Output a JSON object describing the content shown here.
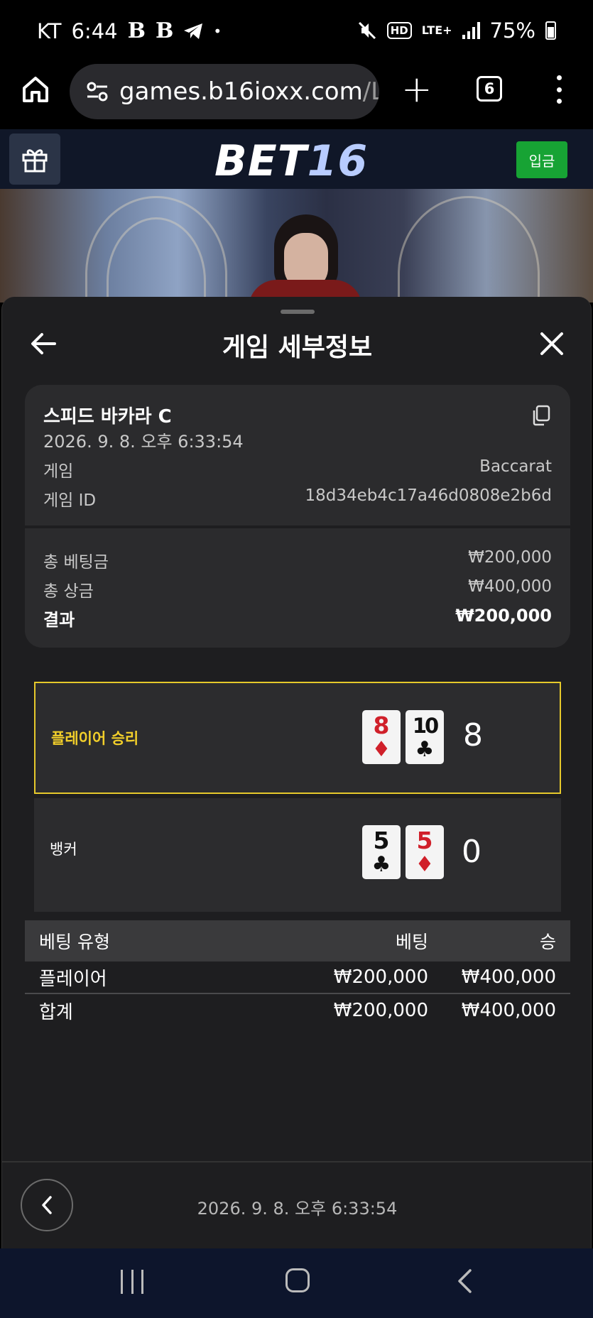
{
  "status_bar": {
    "carrier": "KT",
    "time": "6:44",
    "app_icons": [
      "B",
      "B"
    ],
    "network": "LTE+",
    "hd": "HD",
    "battery": "75%"
  },
  "browser": {
    "url_main": "games.b16ioxx.com",
    "url_rest": "/La",
    "tab_count": "6"
  },
  "site": {
    "logo_a": "BET",
    "logo_b": "16",
    "deposit_label": "입금"
  },
  "sheet": {
    "title": "게임 세부정보",
    "game_name": "스피드 바카라 C",
    "game_datetime": "2026. 9. 8. 오후 6:33:54",
    "game_label": "게임",
    "game_value": "Baccarat",
    "game_id_label": "게임 ID",
    "game_id_value": "18d34eb4c17a46d0808e2b6d",
    "total_bet_label": "총 베팅금",
    "total_bet_value": "₩200,000",
    "total_win_label": "총 상금",
    "total_win_value": "₩400,000",
    "result_label": "결과",
    "result_value": "₩200,000"
  },
  "hands": {
    "player": {
      "label": "플레이어 승리",
      "cards": [
        {
          "rank": "8",
          "suit": "♦"
        },
        {
          "rank": "10",
          "suit": "♣"
        }
      ],
      "score": "8"
    },
    "banker": {
      "label": "뱅커",
      "cards": [
        {
          "rank": "5",
          "suit": "♣"
        },
        {
          "rank": "5",
          "suit": "♦"
        }
      ],
      "score": "0"
    }
  },
  "bet_table": {
    "headers": [
      "베팅 유형",
      "베팅",
      "승"
    ],
    "rows": [
      [
        "플레이어",
        "₩200,000",
        "₩400,000"
      ],
      [
        "합계",
        "₩200,000",
        "₩400,000"
      ]
    ]
  },
  "footer": {
    "datetime": "2026. 9. 8. 오후 6:33:54"
  },
  "colors": {
    "win_accent": "#e6c92b",
    "deposit_green": "#17a334",
    "header_navy": "#101728",
    "card_red": "#d0202a"
  }
}
